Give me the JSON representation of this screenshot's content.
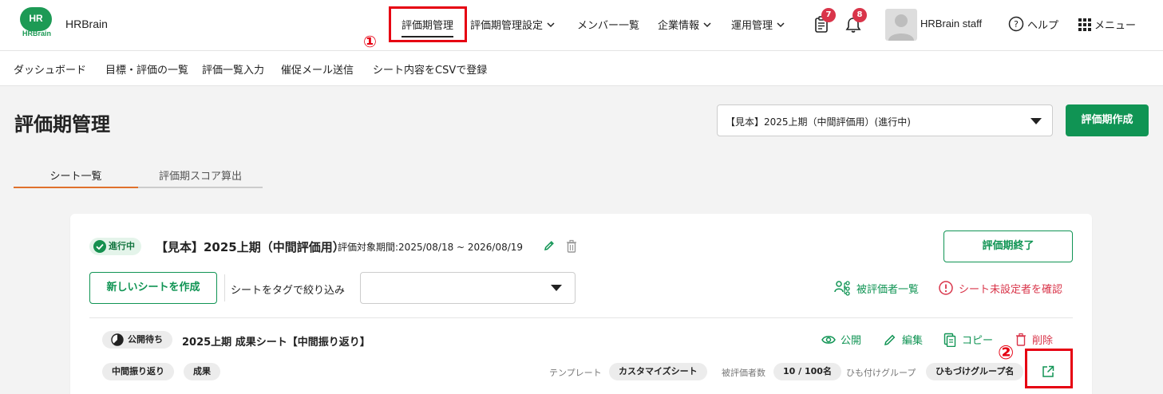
{
  "header": {
    "logo_text": "HR",
    "logo_sub": "HRBrain",
    "brand": "HRBrain",
    "nav": [
      {
        "label": "評価期管理"
      },
      {
        "label": "評価期管理設定"
      },
      {
        "label": "メンバー一覧"
      },
      {
        "label": "企業情報"
      },
      {
        "label": "運用管理"
      }
    ],
    "docs_badge": "7",
    "bell_badge": "8",
    "user_name": "HRBrain staff",
    "help_label": "ヘルプ",
    "menu_label": "メニュー"
  },
  "annotations": {
    "one": "①",
    "two": "②"
  },
  "subnav": [
    "ダッシュボード",
    "目標・評価の一覧",
    "評価一覧入力",
    "催促メール送信",
    "シート内容をCSVで登録"
  ],
  "page": {
    "title": "評価期管理",
    "period_select": "【見本】2025上期（中間評価用）(進行中)",
    "create_button": "評価期作成"
  },
  "tabs": [
    "シート一覧",
    "評価期スコア算出"
  ],
  "period": {
    "status": "進行中",
    "name": "【見本】2025上期（中間評価用）",
    "range": "評価対象期間:2025/08/18 ~ 2026/08/19",
    "end_button": "評価期終了",
    "new_sheet_button": "新しいシートを作成",
    "filter_label": "シートをタグで絞り込み",
    "evaluatee_link": "被評価者一覧",
    "unset_link": "シート未設定者を確認"
  },
  "sheet": {
    "status": "公開待ち",
    "title": "2025上期 成果シート【中間振り返り】",
    "actions": {
      "publish": "公開",
      "edit": "編集",
      "copy": "コピー",
      "delete": "削除"
    },
    "tags": [
      "中間振り返り",
      "成果"
    ],
    "template_label": "テンプレート",
    "template_value": "カスタマイズシート",
    "count_label": "被評価者数",
    "count_value": "10 / 100名",
    "group_label": "ひも付けグループ",
    "group_value": "ひもづけグループ名"
  },
  "colors": {
    "accent": "#109454",
    "danger": "#d9354a",
    "highlight": "#e60012",
    "tab_active": "#e0712c"
  }
}
